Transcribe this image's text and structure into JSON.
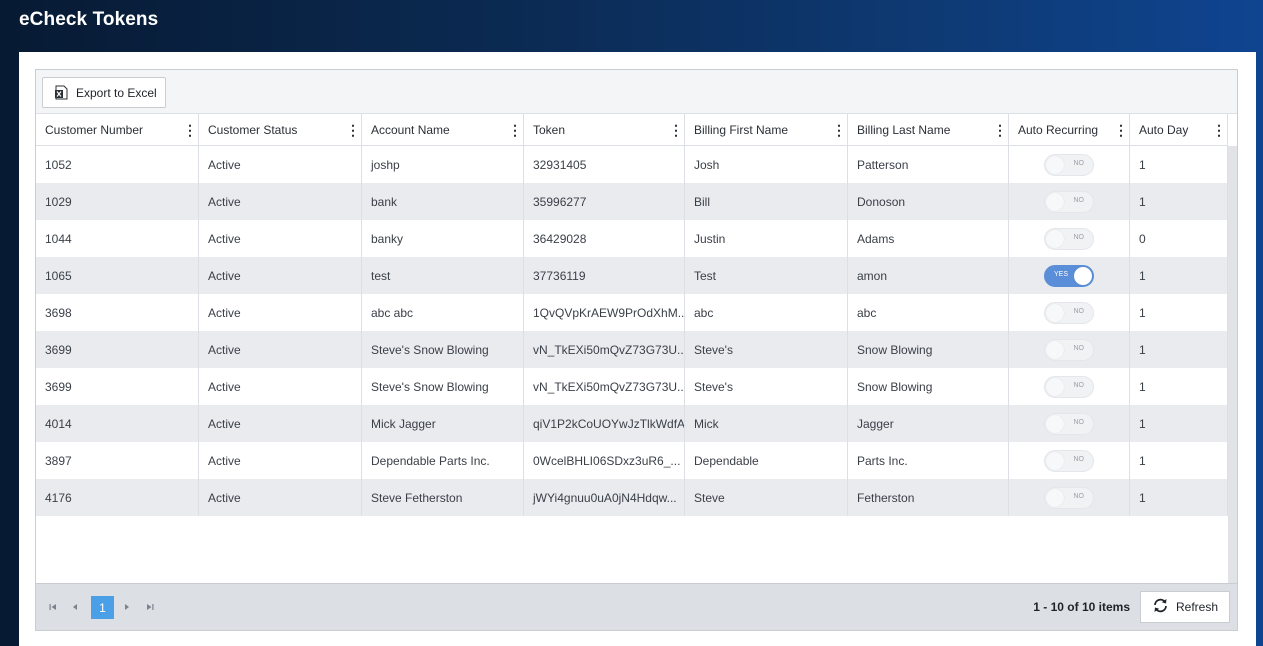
{
  "page": {
    "title": "eCheck Tokens"
  },
  "toolbar": {
    "export_label": "Export to Excel"
  },
  "columns": [
    "Customer Number",
    "Customer Status",
    "Account Name",
    "Token",
    "Billing First Name",
    "Billing Last Name",
    "Auto Recurring",
    "Auto Day"
  ],
  "rows": [
    {
      "customer_number": "1052",
      "status": "Active",
      "account_name": "joshp",
      "token": "32931405",
      "first_name": "Josh",
      "last_name": "Patterson",
      "auto_recurring": "NO",
      "auto_day": "1"
    },
    {
      "customer_number": "1029",
      "status": "Active",
      "account_name": "bank",
      "token": "35996277",
      "first_name": "Bill",
      "last_name": "Donoson",
      "auto_recurring": "NO",
      "auto_day": "1"
    },
    {
      "customer_number": "1044",
      "status": "Active",
      "account_name": "banky",
      "token": "36429028",
      "first_name": "Justin",
      "last_name": "Adams",
      "auto_recurring": "NO",
      "auto_day": "0"
    },
    {
      "customer_number": "1065",
      "status": "Active",
      "account_name": "test",
      "token": "37736119",
      "first_name": "Test",
      "last_name": "amon",
      "auto_recurring": "YES",
      "auto_day": "1"
    },
    {
      "customer_number": "3698",
      "status": "Active",
      "account_name": "abc abc",
      "token": "1QvQVpKrAEW9PrOdXhM...",
      "first_name": "abc",
      "last_name": "abc",
      "auto_recurring": "NO",
      "auto_day": "1"
    },
    {
      "customer_number": "3699",
      "status": "Active",
      "account_name": "Steve's Snow Blowing",
      "token": "vN_TkEXi50mQvZ73G73U...",
      "first_name": "Steve's",
      "last_name": "Snow Blowing",
      "auto_recurring": "NO",
      "auto_day": "1"
    },
    {
      "customer_number": "3699",
      "status": "Active",
      "account_name": "Steve's Snow Blowing",
      "token": "vN_TkEXi50mQvZ73G73U...",
      "first_name": "Steve's",
      "last_name": "Snow Blowing",
      "auto_recurring": "NO",
      "auto_day": "1"
    },
    {
      "customer_number": "4014",
      "status": "Active",
      "account_name": "Mick Jagger",
      "token": "qiV1P2kCoUOYwJzTlkWdfA",
      "first_name": "Mick",
      "last_name": "Jagger",
      "auto_recurring": "NO",
      "auto_day": "1"
    },
    {
      "customer_number": "3897",
      "status": "Active",
      "account_name": "Dependable Parts Inc.",
      "token": "0WcelBHLI06SDxz3uR6_...",
      "first_name": "Dependable",
      "last_name": "Parts Inc.",
      "auto_recurring": "NO",
      "auto_day": "1"
    },
    {
      "customer_number": "4176",
      "status": "Active",
      "account_name": "Steve Fetherston",
      "token": "jWYi4gnuu0uA0jN4Hdqw...",
      "first_name": "Steve",
      "last_name": "Fetherston",
      "auto_recurring": "NO",
      "auto_day": "1"
    }
  ],
  "pager": {
    "first_icon": "first-page-icon",
    "prev_icon": "prev-page-icon",
    "next_icon": "next-page-icon",
    "last_icon": "last-page-icon",
    "current_page": "1",
    "info": "1 - 10 of 10 items",
    "refresh_label": "Refresh"
  },
  "colors": {
    "accent": "#4a9fe6",
    "toggle_on": "#5b8ed8",
    "header_dark": "#071a33",
    "header_light": "#0f4490"
  }
}
